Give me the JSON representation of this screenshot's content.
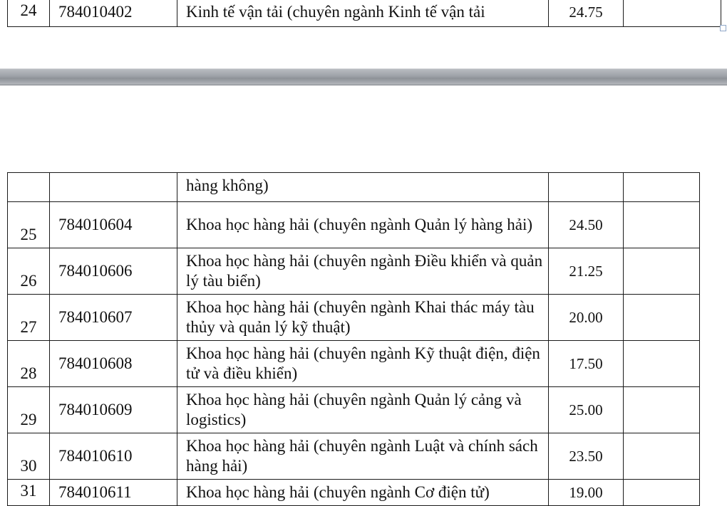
{
  "page_top": {
    "row": {
      "no": "24",
      "code": "784010402",
      "name": "Kinh tế vận tải (chuyên ngành Kinh tế vận tải",
      "score": "24.75"
    }
  },
  "page_bottom": {
    "continuation": {
      "name": "hàng không)"
    },
    "rows": [
      {
        "no": "25",
        "code": "784010604",
        "name": "Khoa học hàng hải (chuyên ngành Quản lý hàng hải)",
        "score": "24.50"
      },
      {
        "no": "26",
        "code": "784010606",
        "name": "Khoa học hàng hải (chuyên ngành Điều khiển và quản lý tàu biển)",
        "score": "21.25"
      },
      {
        "no": "27",
        "code": "784010607",
        "name": "Khoa học hàng hải (chuyên ngành Khai thác máy tàu thủy và quản lý kỹ thuật)",
        "score": "20.00"
      },
      {
        "no": "28",
        "code": "784010608",
        "name": "Khoa học hàng hải (chuyên ngành Kỹ thuật điện, điện tử và điều khiển)",
        "score": "17.50"
      },
      {
        "no": "29",
        "code": "784010609",
        "name": "Khoa học hàng hải (chuyên ngành Quản lý cảng và logistics)",
        "score": "25.00"
      },
      {
        "no": "30",
        "code": "784010610",
        "name": "Khoa học hàng hải (chuyên ngành Luật và chính sách hàng hải)",
        "score": "23.50"
      },
      {
        "no": "31",
        "code": "784010611",
        "name": "Khoa học hàng hải (chuyên ngành Cơ điện tử)",
        "score": "19.00"
      }
    ]
  }
}
